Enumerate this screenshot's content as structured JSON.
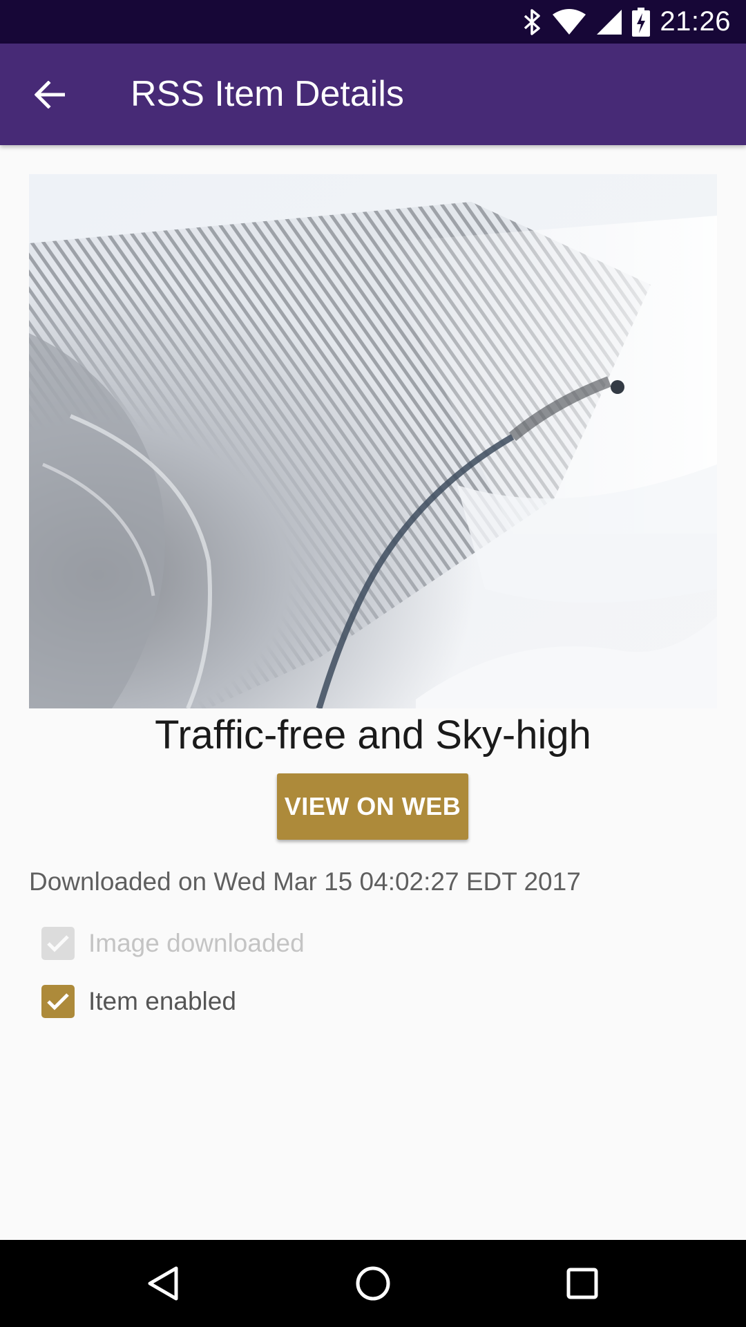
{
  "status_bar": {
    "time": "21:26",
    "icons": [
      "bluetooth-icon",
      "wifi-icon",
      "signal-icon",
      "battery-charging-icon"
    ]
  },
  "app_bar": {
    "title": "RSS Item Details",
    "back_icon": "arrow-back-icon"
  },
  "item": {
    "title": "Traffic-free and Sky-high",
    "view_button_label": "VIEW ON WEB",
    "downloaded_text": "Downloaded on Wed Mar 15 04:02:27 EDT 2017"
  },
  "checkboxes": [
    {
      "label": "Image downloaded",
      "checked": true,
      "enabled": false
    },
    {
      "label": "Item enabled",
      "checked": true,
      "enabled": true
    }
  ],
  "nav_bar": {
    "icons": [
      "nav-back-icon",
      "nav-home-icon",
      "nav-recents-icon"
    ]
  },
  "colors": {
    "status_bar": "#170737",
    "app_bar": "#472a76",
    "accent": "#ad8a3a",
    "background": "#fafafa"
  }
}
